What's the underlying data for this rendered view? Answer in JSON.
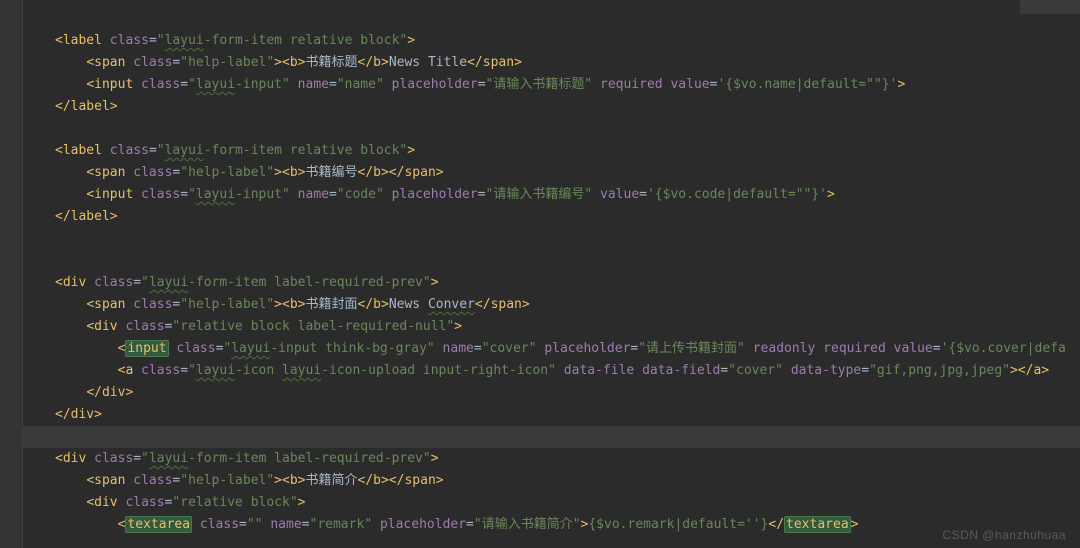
{
  "editor": {
    "watermark": "CSDN @hanzhuhuaa",
    "highlight_line_index": 19,
    "lines": [
      {
        "indent": 0,
        "tokens": []
      },
      {
        "indent": 0,
        "tokens": [
          {
            "t": "br",
            "v": "<"
          },
          {
            "t": "tag",
            "v": "label "
          },
          {
            "t": "attr",
            "v": "class"
          },
          {
            "t": "eq",
            "v": "="
          },
          {
            "t": "str",
            "v": "\""
          },
          {
            "t": "str",
            "wavy": true,
            "v": "layui"
          },
          {
            "t": "str",
            "v": "-form-item relative block\""
          },
          {
            "t": "br",
            "v": ">"
          }
        ]
      },
      {
        "indent": 1,
        "tokens": [
          {
            "t": "br",
            "v": "<"
          },
          {
            "t": "tag",
            "v": "span "
          },
          {
            "t": "attr",
            "v": "class"
          },
          {
            "t": "eq",
            "v": "="
          },
          {
            "t": "str",
            "v": "\"help-label\""
          },
          {
            "t": "br",
            "v": "><"
          },
          {
            "t": "tag",
            "v": "b"
          },
          {
            "t": "br",
            "v": ">"
          },
          {
            "t": "plain",
            "v": "书籍标题"
          },
          {
            "t": "br",
            "v": "</"
          },
          {
            "t": "tag",
            "v": "b"
          },
          {
            "t": "br",
            "v": ">"
          },
          {
            "t": "plain",
            "v": "News Title"
          },
          {
            "t": "br",
            "v": "</"
          },
          {
            "t": "tag",
            "v": "span"
          },
          {
            "t": "br",
            "v": ">"
          }
        ]
      },
      {
        "indent": 1,
        "tokens": [
          {
            "t": "br",
            "v": "<"
          },
          {
            "t": "tag",
            "v": "input "
          },
          {
            "t": "attr",
            "v": "class"
          },
          {
            "t": "eq",
            "v": "="
          },
          {
            "t": "str",
            "v": "\""
          },
          {
            "t": "str",
            "wavy": true,
            "v": "layui"
          },
          {
            "t": "str",
            "v": "-input\" "
          },
          {
            "t": "attr",
            "v": "name"
          },
          {
            "t": "eq",
            "v": "="
          },
          {
            "t": "str",
            "v": "\"name\" "
          },
          {
            "t": "attr",
            "v": "placeholder"
          },
          {
            "t": "eq",
            "v": "="
          },
          {
            "t": "str",
            "v": "\"请输入书籍标题\" "
          },
          {
            "t": "attr",
            "v": "required "
          },
          {
            "t": "attr",
            "v": "value"
          },
          {
            "t": "eq",
            "v": "="
          },
          {
            "t": "str",
            "v": "'{$vo.name|default=\"\"}'"
          },
          {
            "t": "br",
            "v": ">"
          }
        ]
      },
      {
        "indent": 0,
        "tokens": [
          {
            "t": "br",
            "v": "</"
          },
          {
            "t": "tag",
            "v": "label"
          },
          {
            "t": "br",
            "v": ">"
          }
        ]
      },
      {
        "indent": 0,
        "tokens": []
      },
      {
        "indent": 0,
        "tokens": [
          {
            "t": "br",
            "v": "<"
          },
          {
            "t": "tag",
            "v": "label "
          },
          {
            "t": "attr",
            "v": "class"
          },
          {
            "t": "eq",
            "v": "="
          },
          {
            "t": "str",
            "v": "\""
          },
          {
            "t": "str",
            "wavy": true,
            "v": "layui"
          },
          {
            "t": "str",
            "v": "-form-item relative block\""
          },
          {
            "t": "br",
            "v": ">"
          }
        ]
      },
      {
        "indent": 1,
        "tokens": [
          {
            "t": "br",
            "v": "<"
          },
          {
            "t": "tag",
            "v": "span "
          },
          {
            "t": "attr",
            "v": "class"
          },
          {
            "t": "eq",
            "v": "="
          },
          {
            "t": "str",
            "v": "\"help-label\""
          },
          {
            "t": "br",
            "v": "><"
          },
          {
            "t": "tag",
            "v": "b"
          },
          {
            "t": "br",
            "v": ">"
          },
          {
            "t": "plain",
            "v": "书籍编号"
          },
          {
            "t": "br",
            "v": "</"
          },
          {
            "t": "tag",
            "v": "b"
          },
          {
            "t": "br",
            "v": "></"
          },
          {
            "t": "tag",
            "v": "span"
          },
          {
            "t": "br",
            "v": ">"
          }
        ]
      },
      {
        "indent": 1,
        "tokens": [
          {
            "t": "br",
            "v": "<"
          },
          {
            "t": "tag",
            "v": "input "
          },
          {
            "t": "attr",
            "v": "class"
          },
          {
            "t": "eq",
            "v": "="
          },
          {
            "t": "str",
            "v": "\""
          },
          {
            "t": "str",
            "wavy": true,
            "v": "layui"
          },
          {
            "t": "str",
            "v": "-input\" "
          },
          {
            "t": "attr",
            "v": "name"
          },
          {
            "t": "eq",
            "v": "="
          },
          {
            "t": "str",
            "v": "\"code\" "
          },
          {
            "t": "attr",
            "v": "placeholder"
          },
          {
            "t": "eq",
            "v": "="
          },
          {
            "t": "str",
            "v": "\"请输入书籍编号\" "
          },
          {
            "t": "attr",
            "v": "value"
          },
          {
            "t": "eq",
            "v": "="
          },
          {
            "t": "str",
            "v": "'{$vo.code|default=\"\"}'"
          },
          {
            "t": "br",
            "v": ">"
          }
        ]
      },
      {
        "indent": 0,
        "tokens": [
          {
            "t": "br",
            "v": "</"
          },
          {
            "t": "tag",
            "v": "label"
          },
          {
            "t": "br",
            "v": ">"
          }
        ]
      },
      {
        "indent": 0,
        "tokens": []
      },
      {
        "indent": 0,
        "tokens": []
      },
      {
        "indent": 0,
        "tokens": [
          {
            "t": "br",
            "v": "<"
          },
          {
            "t": "tag",
            "v": "div "
          },
          {
            "t": "attr",
            "v": "class"
          },
          {
            "t": "eq",
            "v": "="
          },
          {
            "t": "str",
            "v": "\""
          },
          {
            "t": "str",
            "wavy": true,
            "v": "layui"
          },
          {
            "t": "str",
            "v": "-form-item label-required-prev\""
          },
          {
            "t": "br",
            "v": ">"
          }
        ]
      },
      {
        "indent": 1,
        "tokens": [
          {
            "t": "br",
            "v": "<"
          },
          {
            "t": "tag",
            "v": "span "
          },
          {
            "t": "attr",
            "v": "class"
          },
          {
            "t": "eq",
            "v": "="
          },
          {
            "t": "str",
            "v": "\"help-label\""
          },
          {
            "t": "br",
            "v": "><"
          },
          {
            "t": "tag",
            "v": "b"
          },
          {
            "t": "br",
            "v": ">"
          },
          {
            "t": "plain",
            "v": "书籍封面"
          },
          {
            "t": "br",
            "v": "</"
          },
          {
            "t": "tag",
            "v": "b"
          },
          {
            "t": "br",
            "v": ">"
          },
          {
            "t": "plain",
            "v": "News "
          },
          {
            "t": "plain",
            "wavy": true,
            "v": "Conver"
          },
          {
            "t": "br",
            "v": "</"
          },
          {
            "t": "tag",
            "v": "span"
          },
          {
            "t": "br",
            "v": ">"
          }
        ]
      },
      {
        "indent": 1,
        "tokens": [
          {
            "t": "br",
            "v": "<"
          },
          {
            "t": "tag",
            "v": "div "
          },
          {
            "t": "attr",
            "v": "class"
          },
          {
            "t": "eq",
            "v": "="
          },
          {
            "t": "str",
            "v": "\"relative block label-required-null\""
          },
          {
            "t": "br",
            "v": ">"
          }
        ]
      },
      {
        "indent": 2,
        "tokens": [
          {
            "t": "br",
            "v": "<"
          },
          {
            "t": "tag",
            "box": true,
            "v": "input"
          },
          {
            "t": "tag",
            "v": " "
          },
          {
            "t": "attr",
            "v": "class"
          },
          {
            "t": "eq",
            "v": "="
          },
          {
            "t": "str",
            "v": "\""
          },
          {
            "t": "str",
            "wavy": true,
            "v": "layui"
          },
          {
            "t": "str",
            "v": "-input think-bg-gray\" "
          },
          {
            "t": "attr",
            "v": "name"
          },
          {
            "t": "eq",
            "v": "="
          },
          {
            "t": "str",
            "v": "\"cover\" "
          },
          {
            "t": "attr",
            "v": "placeholder"
          },
          {
            "t": "eq",
            "v": "="
          },
          {
            "t": "str",
            "v": "\"请上传书籍封面\" "
          },
          {
            "t": "attr",
            "v": "readonly "
          },
          {
            "t": "attr",
            "v": "required "
          },
          {
            "t": "attr",
            "v": "value"
          },
          {
            "t": "eq",
            "v": "="
          },
          {
            "t": "str",
            "v": "'{$vo.cover|defa"
          }
        ]
      },
      {
        "indent": 2,
        "tokens": [
          {
            "t": "br",
            "v": "<"
          },
          {
            "t": "tag",
            "v": "a "
          },
          {
            "t": "attr",
            "v": "class"
          },
          {
            "t": "eq",
            "v": "="
          },
          {
            "t": "str",
            "v": "\""
          },
          {
            "t": "str",
            "wavy": true,
            "v": "layui"
          },
          {
            "t": "str",
            "v": "-icon "
          },
          {
            "t": "str",
            "wavy": true,
            "v": "layui"
          },
          {
            "t": "str",
            "v": "-icon-upload input-right-icon\" "
          },
          {
            "t": "attr",
            "v": "data-file "
          },
          {
            "t": "attr",
            "v": "data-field"
          },
          {
            "t": "eq",
            "v": "="
          },
          {
            "t": "str",
            "v": "\"cover\" "
          },
          {
            "t": "attr",
            "v": "data-type"
          },
          {
            "t": "eq",
            "v": "="
          },
          {
            "t": "str",
            "v": "\"gif,png,jpg,jpeg\""
          },
          {
            "t": "br",
            "v": "></"
          },
          {
            "t": "tag",
            "v": "a"
          },
          {
            "t": "br",
            "v": ">"
          }
        ]
      },
      {
        "indent": 1,
        "tokens": [
          {
            "t": "br",
            "v": "</"
          },
          {
            "t": "tag",
            "v": "div"
          },
          {
            "t": "br",
            "v": ">"
          }
        ]
      },
      {
        "indent": 0,
        "tokens": [
          {
            "t": "br",
            "v": "</"
          },
          {
            "t": "tag",
            "v": "div"
          },
          {
            "t": "br",
            "v": ">"
          }
        ]
      },
      {
        "indent": 0,
        "tokens": []
      },
      {
        "indent": 0,
        "tokens": [
          {
            "t": "br",
            "v": "<"
          },
          {
            "t": "tag",
            "v": "div "
          },
          {
            "t": "attr",
            "v": "class"
          },
          {
            "t": "eq",
            "v": "="
          },
          {
            "t": "str",
            "v": "\""
          },
          {
            "t": "str",
            "wavy": true,
            "v": "layui"
          },
          {
            "t": "str",
            "v": "-form-item label-required-prev\""
          },
          {
            "t": "br",
            "v": ">"
          }
        ]
      },
      {
        "indent": 1,
        "tokens": [
          {
            "t": "br",
            "v": "<"
          },
          {
            "t": "tag",
            "v": "span "
          },
          {
            "t": "attr",
            "v": "class"
          },
          {
            "t": "eq",
            "v": "="
          },
          {
            "t": "str",
            "v": "\"help-label\""
          },
          {
            "t": "br",
            "v": "><"
          },
          {
            "t": "tag",
            "v": "b"
          },
          {
            "t": "br",
            "v": ">"
          },
          {
            "t": "plain",
            "v": "书籍简介"
          },
          {
            "t": "br",
            "v": "</"
          },
          {
            "t": "tag",
            "v": "b"
          },
          {
            "t": "br",
            "v": "></"
          },
          {
            "t": "tag",
            "v": "span"
          },
          {
            "t": "br",
            "v": ">"
          }
        ]
      },
      {
        "indent": 1,
        "tokens": [
          {
            "t": "br",
            "v": "<"
          },
          {
            "t": "tag",
            "v": "div "
          },
          {
            "t": "attr",
            "v": "class"
          },
          {
            "t": "eq",
            "v": "="
          },
          {
            "t": "str",
            "v": "\"relative block\""
          },
          {
            "t": "br",
            "v": ">"
          }
        ]
      },
      {
        "indent": 2,
        "tokens": [
          {
            "t": "br",
            "v": "<"
          },
          {
            "t": "tag",
            "box": true,
            "v": "textarea"
          },
          {
            "t": "tag",
            "v": " "
          },
          {
            "t": "attr",
            "v": "class"
          },
          {
            "t": "eq",
            "v": "="
          },
          {
            "t": "str",
            "v": "\"\" "
          },
          {
            "t": "attr",
            "v": "name"
          },
          {
            "t": "eq",
            "v": "="
          },
          {
            "t": "str",
            "v": "\"remark\" "
          },
          {
            "t": "attr",
            "v": "placeholder"
          },
          {
            "t": "eq",
            "v": "="
          },
          {
            "t": "str",
            "v": "\"请输入书籍简介\""
          },
          {
            "t": "br",
            "v": ">"
          },
          {
            "t": "str",
            "v": "{$vo.remark|default=''}"
          },
          {
            "t": "br",
            "v": "</"
          },
          {
            "t": "tag",
            "box": true,
            "v": "textarea"
          },
          {
            "t": "br",
            "v": ">"
          }
        ]
      }
    ]
  }
}
